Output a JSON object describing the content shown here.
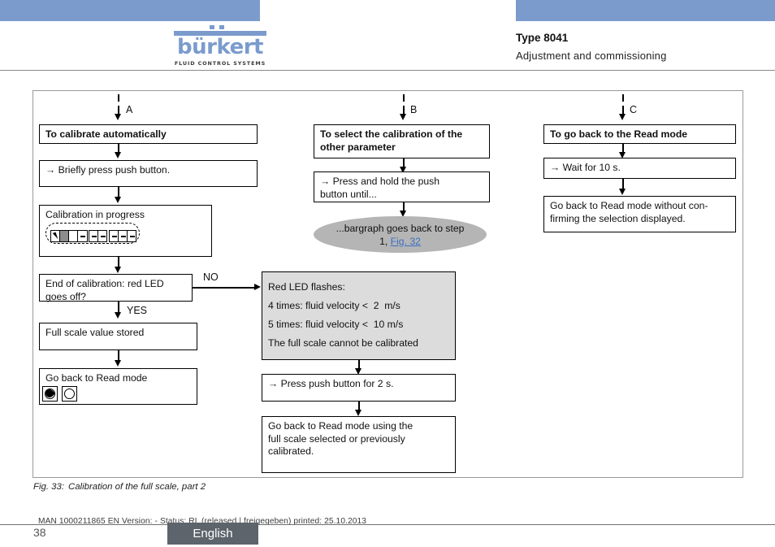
{
  "header": {
    "logo_word": "bürkert",
    "logo_sub": "FLUID CONTROL SYSTEMS",
    "type": "Type 8041",
    "subtitle": "Adjustment and commissioning"
  },
  "flow": {
    "branch_a": {
      "tag": "A",
      "title": "To calibrate automatically",
      "action": "→ Briefly press push button.",
      "progress_title": "Calibration in progress",
      "decision_l1": "End of calibration: red LED",
      "decision_l2": "goes off?",
      "label_no": "NO",
      "label_yes": "YES",
      "stored": "Full scale value stored",
      "read_mode": "Go back to Read mode"
    },
    "branch_b": {
      "tag": "B",
      "title_l1": "To select the calibration of the",
      "title_l2": "other parameter",
      "action_l1": "→ Press and hold the push",
      "action_l2": "button until...",
      "oval_l1": "...bargraph goes back to step",
      "oval_l2_pre": "1, ",
      "oval_link": "Fig. 32"
    },
    "branch_c": {
      "tag": "C",
      "title": "To go back to the Read mode",
      "action": "→ Wait for 10 s.",
      "result_l1": "Go back to Read mode without con-",
      "result_l2": "firming the selection displayed."
    },
    "error_box": {
      "l1": "Red LED flashes:",
      "l2": "4 times: fluid velocity <  2  m/s",
      "l3": "5 times: fluid velocity <  10 m/s",
      "l4": "The full scale cannot be calibrated"
    },
    "error_action": "→ Press push button for 2 s.",
    "error_result_l1": "Go back to Read mode using the",
    "error_result_l2": "full scale selected or previously",
    "error_result_l3": "calibrated."
  },
  "caption": {
    "number": "Fig. 33:",
    "text": "Calibration of the full scale, part 2"
  },
  "footer": {
    "man_line": "MAN  1000211865  EN  Version: - Status: RL  (released | freigegeben)  printed: 25.10.2013",
    "page": "38",
    "language": "English"
  },
  "colors": {
    "brand_blue": "#7b9bcd",
    "link_blue": "#3b6fc4",
    "gray_box": "#dcdcdc",
    "oval_gray": "#b5b5b5",
    "tab_gray": "#5d646b"
  }
}
